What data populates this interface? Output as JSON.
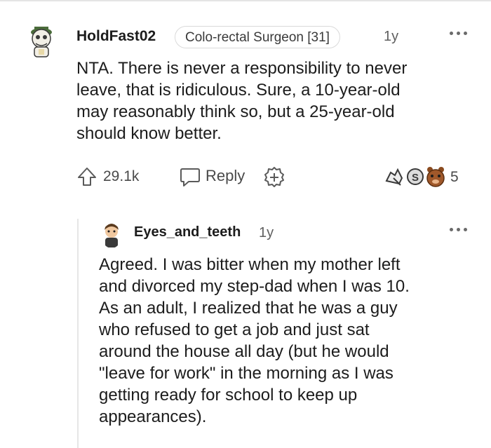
{
  "comment": {
    "username": "HoldFast02",
    "flair": "Colo-rectal Surgeon [31]",
    "age": "1y",
    "body": [
      "NTA. There is never a responsibility to never",
      "leave, that is ridiculous. Sure, a 10-year-old",
      "may reasonably think so, but a 25-year-old",
      "should know better."
    ],
    "score": "29.1k",
    "reply_label": "Reply",
    "award_count": "5"
  },
  "reply": {
    "username": "Eyes_and_teeth",
    "age": "1y",
    "body": [
      "Agreed. I was bitter when my mother left",
      "and divorced my step-dad when I was 10.",
      "As an adult, I realized that he was a guy",
      "who refused to get a job and just sat",
      "around the house all day (but he would",
      "\"leave for work\" in the morning as I was",
      "getting ready for school to keep up",
      "appearances)."
    ]
  },
  "icons": [
    "upvote-icon",
    "reply-icon",
    "give-award-icon",
    "more-options-icon",
    "award-icon"
  ],
  "colors": {
    "text": "#1c1c1c",
    "meta": "#5f5f5f",
    "border": "#dadada",
    "thread_line": "#e6e6e6"
  }
}
